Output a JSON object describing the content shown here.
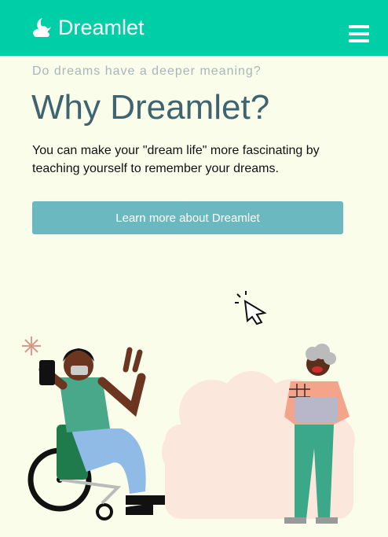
{
  "navbar": {
    "brand_name": "Dreamlet",
    "brand_icon": "moon-cloud-icon",
    "menu_icon": "hamburger-menu-icon"
  },
  "hero": {
    "eyebrow": "Do dreams have a deeper meaning?",
    "title": "Why Dreamlet?",
    "lead": "You can make your \"dream life\" more fascinating by teaching yourself to remember your dreams.",
    "cta_label": "Learn more about Dreamlet"
  },
  "colors": {
    "navbar": "#00cea6",
    "page_background": "#fbfdeb",
    "title": "#3f6470",
    "eyebrow": "#a9b4bd",
    "button": "#6bb8c1"
  }
}
